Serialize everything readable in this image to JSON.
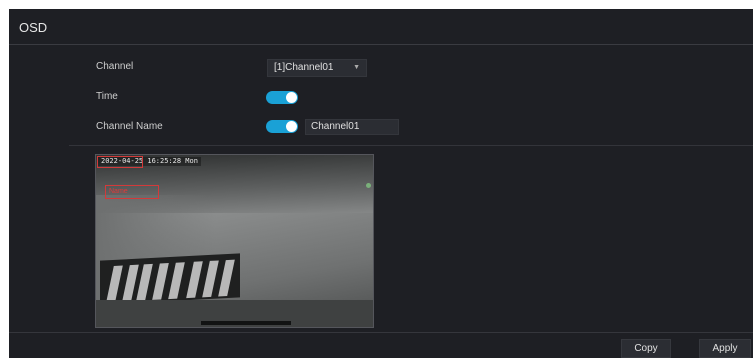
{
  "page": {
    "title": "OSD"
  },
  "form": {
    "channel": {
      "label": "Channel",
      "value": "[1]Channel01"
    },
    "time": {
      "label": "Time",
      "enabled": true
    },
    "channel_name": {
      "label": "Channel Name",
      "enabled": true,
      "value": "Channel01"
    }
  },
  "preview": {
    "time_overlay": "2022-04-25 16:25:28 Mon",
    "name_overlay": "Name"
  },
  "actions": {
    "copy_label": "Copy",
    "apply_label": "Apply"
  },
  "colors": {
    "accent": "#1aa1d6",
    "background": "#1e1f24",
    "overlay_box": "#d33a3a"
  }
}
